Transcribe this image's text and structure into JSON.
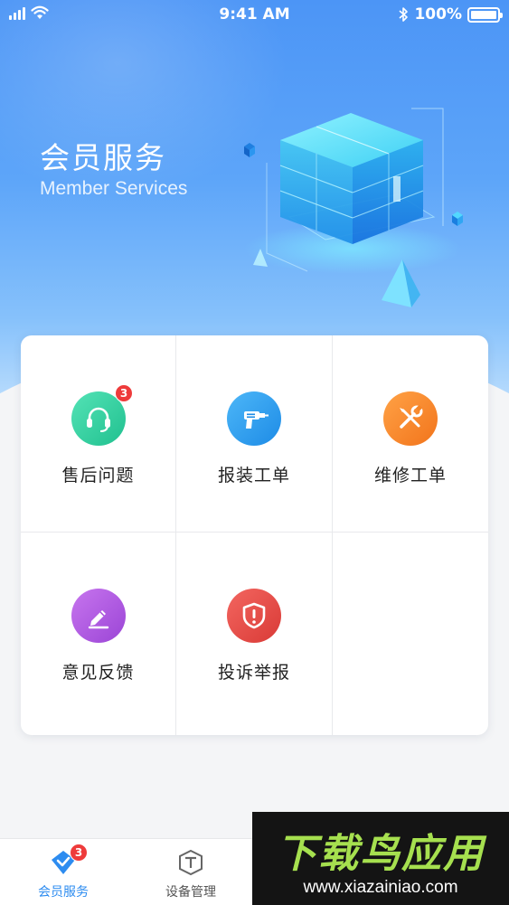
{
  "status_bar": {
    "time": "9:41 AM",
    "battery": "100%",
    "icons": [
      "signal-icon",
      "wifi-icon",
      "bluetooth-icon",
      "battery-icon"
    ]
  },
  "hero": {
    "title": "会员服务",
    "subtitle": "Member Services",
    "illustration": "cube-illustration"
  },
  "services": [
    {
      "label": "售后问题",
      "icon": "headset-icon",
      "color": "#2fcf9e",
      "badge": "3"
    },
    {
      "label": "报装工单",
      "icon": "drill-icon",
      "color": "#2f9ef0"
    },
    {
      "label": "维修工单",
      "icon": "wrench-screwdriver-icon",
      "color": "#f78a2b"
    },
    {
      "label": "意见反馈",
      "icon": "pencil-icon",
      "color": "#b25ce0"
    },
    {
      "label": "投诉举报",
      "icon": "shield-alert-icon",
      "color": "#e84b46"
    }
  ],
  "tabbar": {
    "tabs": [
      {
        "label": "会员服务",
        "icon": "member-service-icon",
        "active": true,
        "badge": "3"
      },
      {
        "label": "设备管理",
        "icon": "device-manage-icon",
        "active": false
      }
    ],
    "active_color": "#2d8cf0",
    "inactive_color": "#555555"
  },
  "watermark": {
    "title": "下载鸟应用",
    "url": "www.xiazainiao.com"
  }
}
